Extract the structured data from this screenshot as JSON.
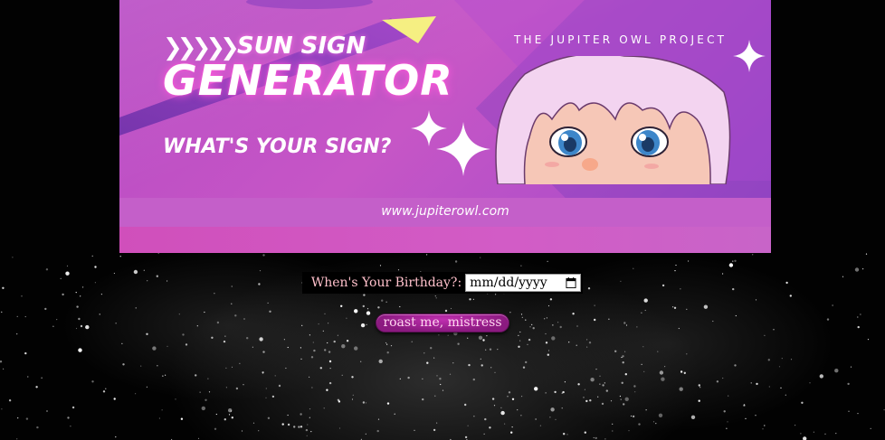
{
  "banner": {
    "chevrons": "❯❯❯❯❯",
    "sun_sign": "SUN SIGN",
    "generator": "GENERATOR",
    "question": "WHAT'S YOUR SIGN?",
    "project": "THE JUPITER OWL PROJECT",
    "url": "www.jupiterowl.com"
  },
  "form": {
    "birthday_label": "When's Your Birthday?:",
    "date_placeholder": "mm/dd/yyyy",
    "submit_label": "roast me, mistress"
  },
  "icons": {
    "calendar": "calendar-icon",
    "sparkle": "sparkle-icon"
  },
  "colors": {
    "label_text": "#ffc0cb",
    "button_bg": "#a0229a",
    "banner_bg": "#c656c6"
  }
}
